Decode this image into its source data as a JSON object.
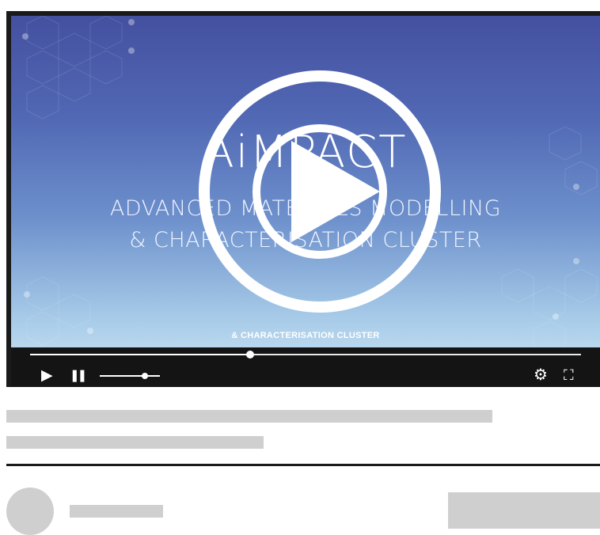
{
  "video": {
    "brand_title": "AiMPACT",
    "headline_line1": "ADVANCED MATERIALS MODELLING",
    "headline_line2": "& CHARACTERISATION CLUSTER",
    "caption": "& CHARACTERISATION CLUSTER"
  },
  "player": {
    "progress_fraction": 0.4,
    "volume_fraction": 0.75,
    "icons": [
      "play-icon",
      "pause-icon",
      "volume-slider",
      "settings-icon",
      "fullscreen-icon"
    ],
    "play_glyph": "▶",
    "pause_glyph": "❚❚",
    "settings_glyph": "⚙",
    "fullscreen_glyph": "⛶"
  },
  "colors": {
    "video_top": "#4450a0",
    "video_bottom": "#bcd9ef",
    "control_bar": "#141414",
    "skeleton": "#cfcfcf"
  }
}
